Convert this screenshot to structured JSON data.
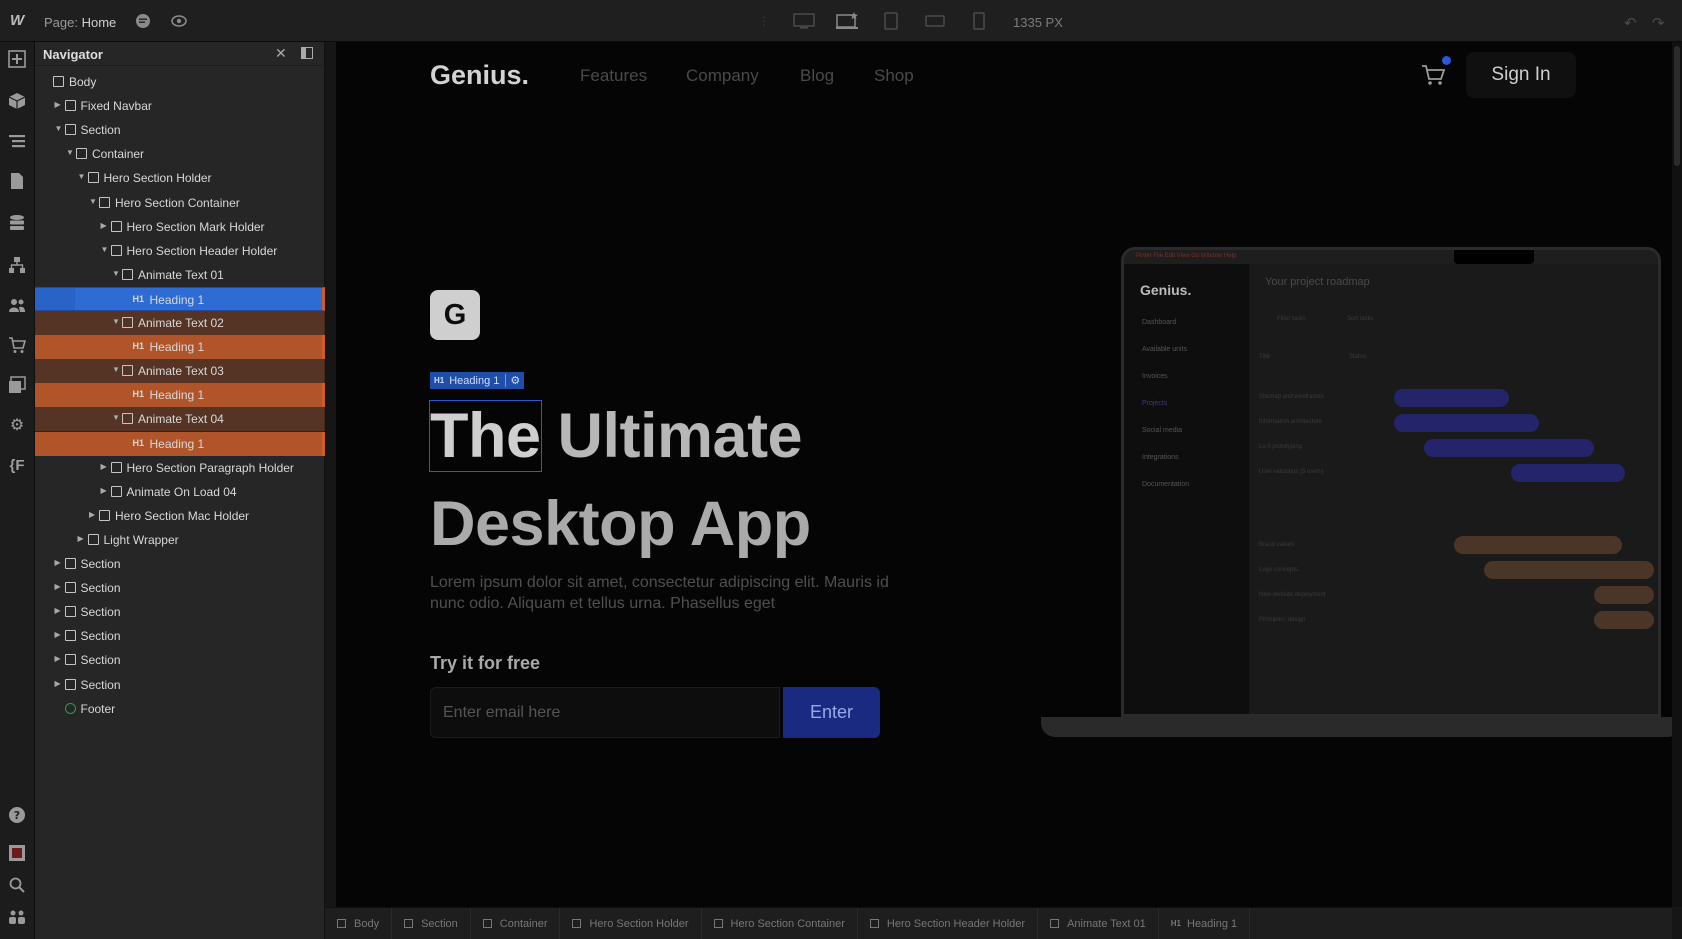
{
  "topbar": {
    "logo": "W",
    "page_prefix": "Page:",
    "page_name": "Home",
    "width_readout": "1335 PX"
  },
  "navigator": {
    "title": "Navigator",
    "rows": [
      {
        "label": "Body",
        "tag": "box"
      },
      {
        "label": "Fixed Navbar",
        "tag": "box"
      },
      {
        "label": "Section",
        "tag": "box"
      },
      {
        "label": "Container",
        "tag": "box"
      },
      {
        "label": "Hero Section Holder",
        "tag": "box"
      },
      {
        "label": "Hero Section Container",
        "tag": "box"
      },
      {
        "label": "Hero Section Mark Holder",
        "tag": "box"
      },
      {
        "label": "Hero Section Header Holder",
        "tag": "box"
      },
      {
        "label": "Animate Text 01",
        "tag": "box"
      },
      {
        "label": "Heading 1",
        "tag": "H1",
        "state": "selected"
      },
      {
        "label": "Animate Text 02",
        "tag": "box"
      },
      {
        "label": "Heading 1",
        "tag": "H1",
        "state": "linked"
      },
      {
        "label": "Animate Text 03",
        "tag": "box"
      },
      {
        "label": "Heading 1",
        "tag": "H1",
        "state": "linked"
      },
      {
        "label": "Animate Text 04",
        "tag": "box"
      },
      {
        "label": "Heading 1",
        "tag": "H1",
        "state": "linked"
      },
      {
        "label": "Hero Section Paragraph Holder",
        "tag": "box"
      },
      {
        "label": "Animate On Load 04",
        "tag": "box"
      },
      {
        "label": "Hero Section Mac Holder",
        "tag": "box"
      },
      {
        "label": "Light Wrapper",
        "tag": "box"
      },
      {
        "label": "Section",
        "tag": "box"
      },
      {
        "label": "Section",
        "tag": "box"
      },
      {
        "label": "Section",
        "tag": "box"
      },
      {
        "label": "Section",
        "tag": "box"
      },
      {
        "label": "Section",
        "tag": "box"
      },
      {
        "label": "Section",
        "tag": "box"
      },
      {
        "label": "Footer",
        "tag": "symbol"
      }
    ]
  },
  "site": {
    "logo": "Genius.",
    "nav": [
      "Features",
      "Company",
      "Blog",
      "Shop"
    ],
    "signin": "Sign In",
    "badge_letter": "G",
    "selection_tag": "Heading 1",
    "headline_word1": "The",
    "headline_word2": "Ultimate",
    "headline_line2": "Desktop App",
    "paragraph": "Lorem ipsum dolor sit amet, consectetur adipiscing elit. Mauris id nunc odio. Aliquam et tellus urna. Phasellus eget",
    "try_label": "Try it for free",
    "email_placeholder": "Enter email here",
    "enter_button": "Enter",
    "accent": "#2c59d9"
  },
  "laptop": {
    "brand": "Genius.",
    "menubar": "Pinter  File  Edit  View  Go  Window  Help",
    "nav": [
      "Dashboard",
      "Available units",
      "Invoices",
      "Projects",
      "Social media",
      "Integrations",
      "Documentation"
    ],
    "title": "Your project roadmap",
    "filter": "Filter tasks",
    "sort": "Sort tasks",
    "col_title": "Title",
    "col_status": "Status",
    "tasks": [
      "Sitemap and wireframes",
      "Information architecture",
      "Lo-fi prototyping",
      "User validation [5 users]",
      "Brand values",
      "Logo concepts",
      "New website deployment",
      "Principles' design"
    ]
  },
  "breadcrumb": [
    "Body",
    "Section",
    "Container",
    "Hero Section Holder",
    "Hero Section Container",
    "Hero Section Header Holder",
    "Animate Text 01",
    "Heading 1"
  ]
}
